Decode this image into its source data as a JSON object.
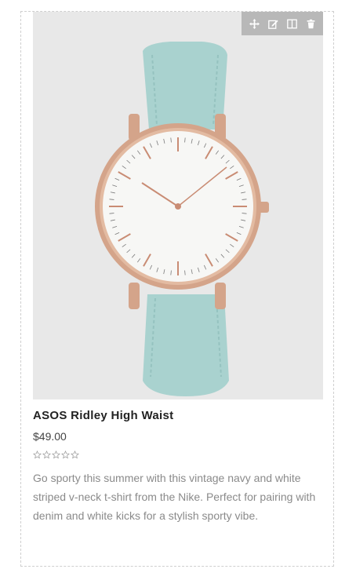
{
  "product": {
    "title": "ASOS Ridley High Waist",
    "price": "$49.00",
    "rating": {
      "value": 0,
      "max": 5
    },
    "description": "Go sporty this summer with this vintage navy and white striped v-neck t-shirt from the Nike. Perfect for pairing with denim and white kicks for a stylish sporty vibe."
  },
  "toolbar": {
    "items": [
      {
        "icon": "move-icon"
      },
      {
        "icon": "edit-icon"
      },
      {
        "icon": "columns-icon"
      },
      {
        "icon": "trash-icon"
      }
    ]
  },
  "colors": {
    "strap": "#a9d2cf",
    "case": "#d4a48a",
    "dial": "#f7f7f5",
    "background": "#e8e8e8"
  }
}
